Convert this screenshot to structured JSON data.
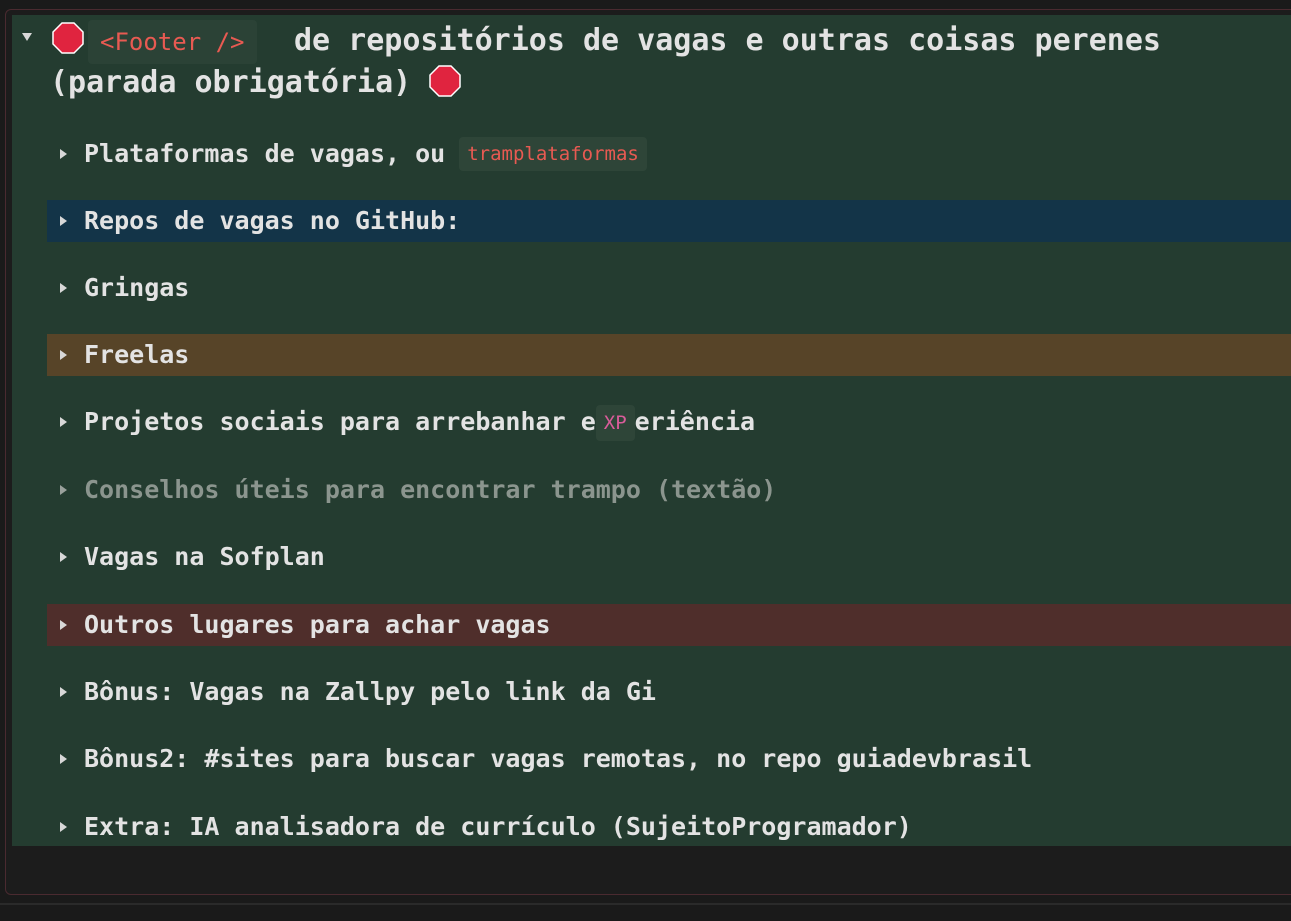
{
  "header": {
    "code": "<Footer />",
    "title_rest": "de repositórios de vagas e outras coisas perenes",
    "title_line2": "(parada obrigatória)"
  },
  "items": [
    {
      "label": "Plataformas de vagas, ou",
      "code": "tramplataformas"
    },
    {
      "label": "Repos de vagas no GitHub:"
    },
    {
      "label": "Gringas"
    },
    {
      "label": "Freelas"
    },
    {
      "label_before": "Projetos sociais para arrebanhar e",
      "code": "XP",
      "label_after": "eriência"
    },
    {
      "label": "Conselhos úteis para encontrar trampo (textão)"
    },
    {
      "label": "Vagas na Sofplan"
    },
    {
      "label": "Outros lugares para achar vagas"
    },
    {
      "label": "Bônus: Vagas na Zallpy pelo link da Gi"
    },
    {
      "label": "Bônus2: #sites para buscar vagas remotas, no repo guiadevbrasil"
    },
    {
      "label": "Extra: IA analisadora de currículo (SujeitoProgramador)"
    }
  ],
  "colors": {
    "panel": "#243c30",
    "highlight_blue": "#133448",
    "highlight_brown": "#574428",
    "highlight_red": "#4f2e2b",
    "code_text": "#e85a52",
    "stop_sign": "#e0243f"
  },
  "icons": [
    "stop-sign-icon",
    "triangle-down-icon",
    "triangle-right-icon"
  ]
}
